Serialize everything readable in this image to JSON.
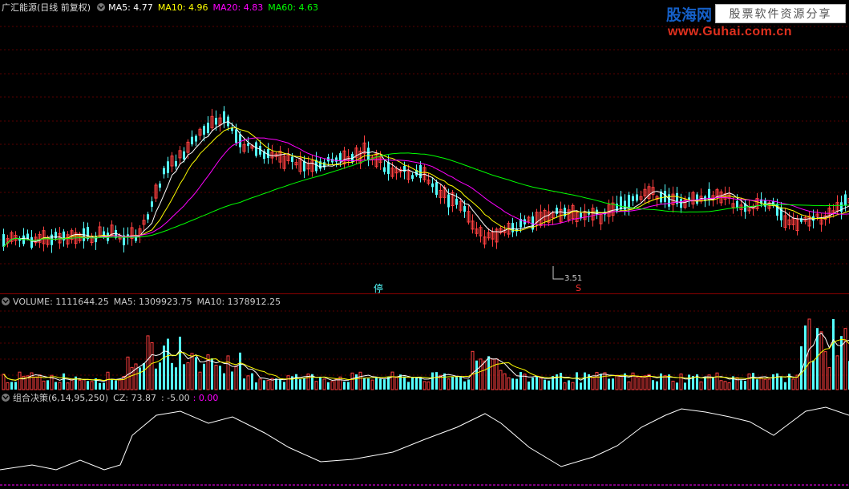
{
  "price": {
    "title": "广汇能源(日线 前复权)",
    "ma_labels": [
      {
        "text": "MA5: 4.77",
        "color": "#ffffff"
      },
      {
        "text": "MA10: 4.96",
        "color": "#ffff00"
      },
      {
        "text": "MA20: 4.83",
        "color": "#ff00ff"
      },
      {
        "text": "MA60: 4.63",
        "color": "#00ff00"
      }
    ],
    "low_marker": "3.51",
    "signal_stop": "停",
    "signal_s": "S",
    "colors": {
      "up": "#ff4444",
      "down": "#54ffff",
      "grid": "#7a0000"
    }
  },
  "volume": {
    "labels": [
      {
        "text": "VOLUME: 1111644.25",
        "color": "#cccccc"
      },
      {
        "text": "MA5: 1309923.75",
        "color": "#cccccc"
      },
      {
        "text": "MA10: 1378912.25",
        "color": "#cccccc"
      }
    ]
  },
  "indicator": {
    "labels": [
      {
        "text": "组合决策(6,14,95,250)",
        "color": "#cccccc"
      },
      {
        "text": "CZ: 73.87",
        "color": "#cccccc"
      },
      {
        "text": ": -5.00",
        "color": "#cccccc"
      },
      {
        "text": ": 0.00",
        "color": "#ff00ff"
      }
    ]
  },
  "watermark": {
    "logo": "股海网",
    "tagline": "股票软件资源分享",
    "url": "www.Guhai.com.cn"
  },
  "icons": {
    "toggle": "chevron-down-icon"
  }
}
